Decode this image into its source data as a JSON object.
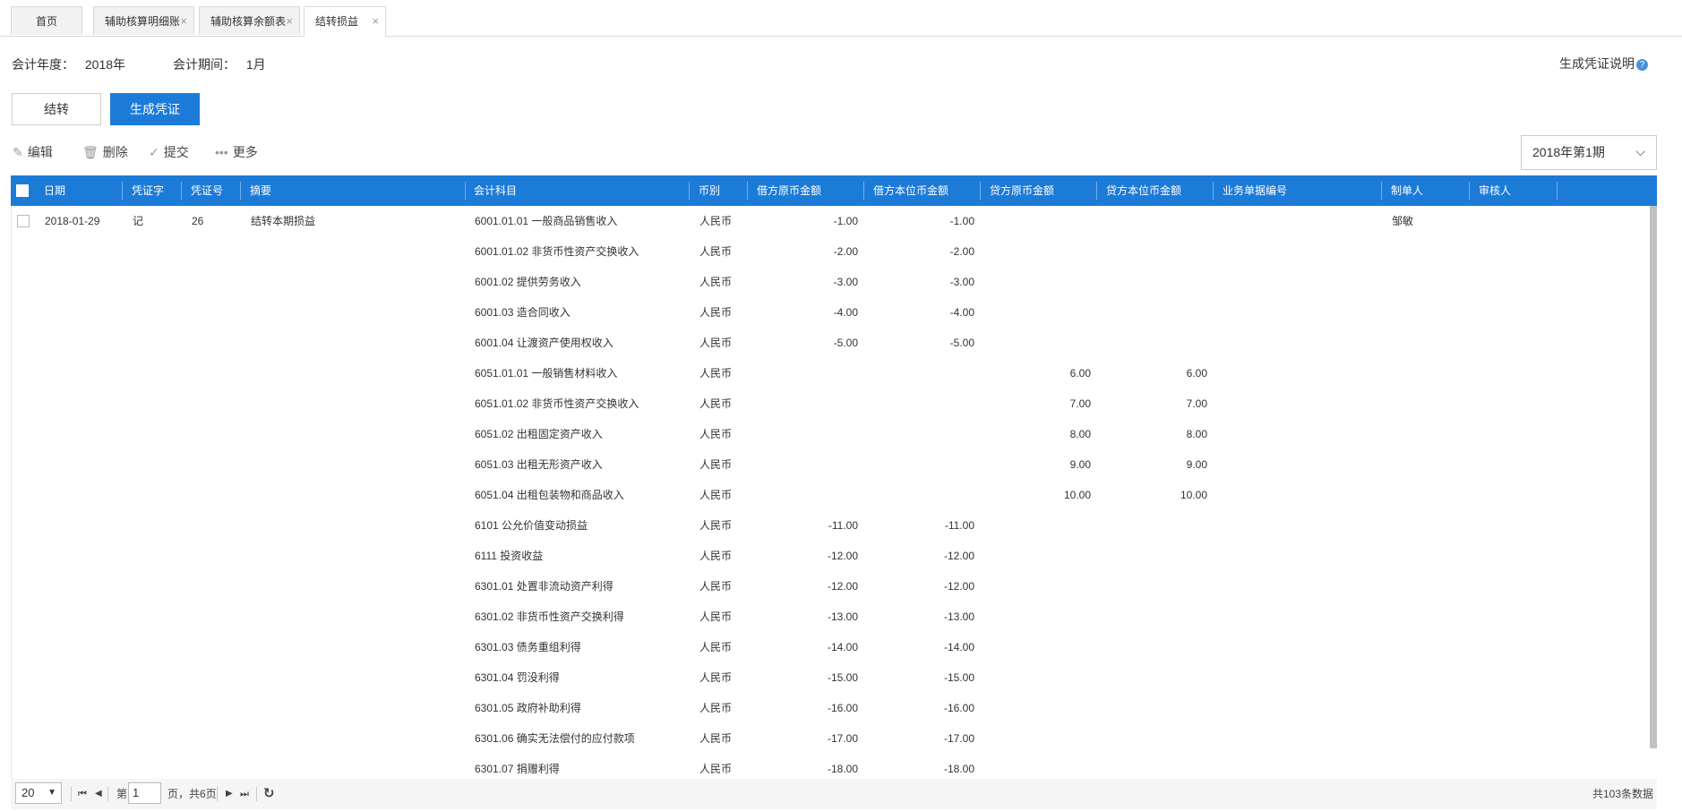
{
  "tabs": [
    {
      "label": "首页",
      "closable": false
    },
    {
      "label": "辅助核算明细账",
      "closable": true
    },
    {
      "label": "辅助核算余额表",
      "closable": true
    },
    {
      "label": "结转损益",
      "closable": true,
      "active": true
    }
  ],
  "close_glyph": "×",
  "header": {
    "year_label": "会计年度：",
    "year_value": "2018年",
    "period_label": "会计期间：",
    "period_value": "1月",
    "help_label": "生成凭证说明",
    "help_icon": "?"
  },
  "buttons": {
    "carry_forward": "结转",
    "generate_voucher": "生成凭证"
  },
  "toolbar": {
    "edit": "编辑",
    "delete": "删除",
    "submit": "提交",
    "more": "更多"
  },
  "period_select": {
    "value": "2018年第1期"
  },
  "columns": [
    "日期",
    "凭证字",
    "凭证号",
    "摘要",
    "会计科目",
    "币别",
    "借方原币金额",
    "借方本位币金额",
    "贷方原币金额",
    "贷方本位币金额",
    "业务单据编号",
    "制单人",
    "审核人"
  ],
  "voucher": {
    "date": "2018-01-29",
    "type": "记",
    "number": "26",
    "summary": "结转本期损益",
    "maker": "邹敏"
  },
  "rows": [
    {
      "account": "6001.01.01 一般商品销售收入",
      "currency": "人民币",
      "debit_orig": "-1.00",
      "debit_base": "-1.00",
      "credit_orig": "",
      "credit_base": ""
    },
    {
      "account": "6001.01.02 非货币性资产交换收入",
      "currency": "人民币",
      "debit_orig": "-2.00",
      "debit_base": "-2.00",
      "credit_orig": "",
      "credit_base": ""
    },
    {
      "account": "6001.02 提供劳务收入",
      "currency": "人民币",
      "debit_orig": "-3.00",
      "debit_base": "-3.00",
      "credit_orig": "",
      "credit_base": ""
    },
    {
      "account": "6001.03 造合同收入",
      "currency": "人民币",
      "debit_orig": "-4.00",
      "debit_base": "-4.00",
      "credit_orig": "",
      "credit_base": ""
    },
    {
      "account": "6001.04 让渡资产使用权收入",
      "currency": "人民币",
      "debit_orig": "-5.00",
      "debit_base": "-5.00",
      "credit_orig": "",
      "credit_base": ""
    },
    {
      "account": "6051.01.01 一般销售材料收入",
      "currency": "人民币",
      "debit_orig": "",
      "debit_base": "",
      "credit_orig": "6.00",
      "credit_base": "6.00"
    },
    {
      "account": "6051.01.02 非货币性资产交换收入",
      "currency": "人民币",
      "debit_orig": "",
      "debit_base": "",
      "credit_orig": "7.00",
      "credit_base": "7.00"
    },
    {
      "account": "6051.02 出租固定资产收入",
      "currency": "人民币",
      "debit_orig": "",
      "debit_base": "",
      "credit_orig": "8.00",
      "credit_base": "8.00"
    },
    {
      "account": "6051.03 出租无形资产收入",
      "currency": "人民币",
      "debit_orig": "",
      "debit_base": "",
      "credit_orig": "9.00",
      "credit_base": "9.00"
    },
    {
      "account": "6051.04 出租包装物和商品收入",
      "currency": "人民币",
      "debit_orig": "",
      "debit_base": "",
      "credit_orig": "10.00",
      "credit_base": "10.00"
    },
    {
      "account": "6101 公允价值变动损益",
      "currency": "人民币",
      "debit_orig": "-11.00",
      "debit_base": "-11.00",
      "credit_orig": "",
      "credit_base": ""
    },
    {
      "account": "6111 投资收益",
      "currency": "人民币",
      "debit_orig": "-12.00",
      "debit_base": "-12.00",
      "credit_orig": "",
      "credit_base": ""
    },
    {
      "account": "6301.01 处置非流动资产利得",
      "currency": "人民币",
      "debit_orig": "-12.00",
      "debit_base": "-12.00",
      "credit_orig": "",
      "credit_base": ""
    },
    {
      "account": "6301.02 非货币性资产交换利得",
      "currency": "人民币",
      "debit_orig": "-13.00",
      "debit_base": "-13.00",
      "credit_orig": "",
      "credit_base": ""
    },
    {
      "account": "6301.03 债务重组利得",
      "currency": "人民币",
      "debit_orig": "-14.00",
      "debit_base": "-14.00",
      "credit_orig": "",
      "credit_base": ""
    },
    {
      "account": "6301.04 罚没利得",
      "currency": "人民币",
      "debit_orig": "-15.00",
      "debit_base": "-15.00",
      "credit_orig": "",
      "credit_base": ""
    },
    {
      "account": "6301.05 政府补助利得",
      "currency": "人民币",
      "debit_orig": "-16.00",
      "debit_base": "-16.00",
      "credit_orig": "",
      "credit_base": ""
    },
    {
      "account": "6301.06 确实无法偿付的应付款项",
      "currency": "人民币",
      "debit_orig": "-17.00",
      "debit_base": "-17.00",
      "credit_orig": "",
      "credit_base": ""
    },
    {
      "account": "6301.07 捐赠利得",
      "currency": "人民币",
      "debit_orig": "-18.00",
      "debit_base": "-18.00",
      "credit_orig": "",
      "credit_base": ""
    }
  ],
  "footer": {
    "page_size": "20",
    "page_prefix": "第",
    "current_page": "1",
    "page_suffix": "页，共6页",
    "total": "共103条数据"
  },
  "colors": {
    "accent": "#1d7bd8",
    "help_icon": "#4a90d9"
  }
}
